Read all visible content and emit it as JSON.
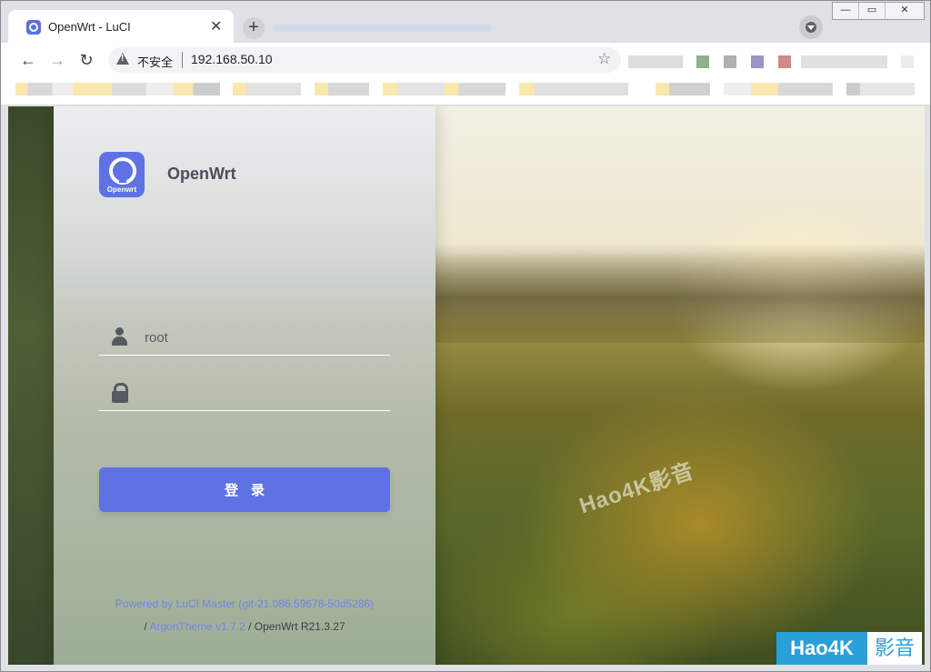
{
  "browser": {
    "tab": {
      "title": "OpenWrt - LuCI",
      "close_glyph": "✕"
    },
    "new_tab_glyph": "+",
    "window_controls": {
      "minimize": "—",
      "maximize": "▭",
      "close": "✕"
    },
    "toolbar": {
      "back_glyph": "←",
      "forward_glyph": "→",
      "reload_glyph": "↻",
      "security_label": "不安全",
      "url": "192.168.50.10",
      "bookmark_glyph": "☆"
    }
  },
  "login": {
    "brand": {
      "logo_text": "Openwrt",
      "name": "OpenWrt"
    },
    "username": {
      "value": "root",
      "placeholder": ""
    },
    "password": {
      "value": "",
      "placeholder": ""
    },
    "submit_label": "登录",
    "footer": {
      "powered_by": "Powered by LuCI Master (git-21.086.59678-50d5286)",
      "separator": "/",
      "theme_link": "ArgonTheme v1.7.2",
      "firmware": "/ OpenWrt R21.3.27"
    }
  },
  "watermark": {
    "diagonal_text": "Hao4K影音",
    "badge_left": "Hao4K",
    "badge_right": "影音"
  },
  "colors": {
    "accent": "#5e72e4",
    "footer_link": "#7383e6",
    "badge_blue": "#2aa0d8"
  },
  "icons": [
    "tab-favicon-icon",
    "warning-icon",
    "star-icon",
    "user-icon",
    "lock-icon",
    "search-tabs-icon"
  ]
}
